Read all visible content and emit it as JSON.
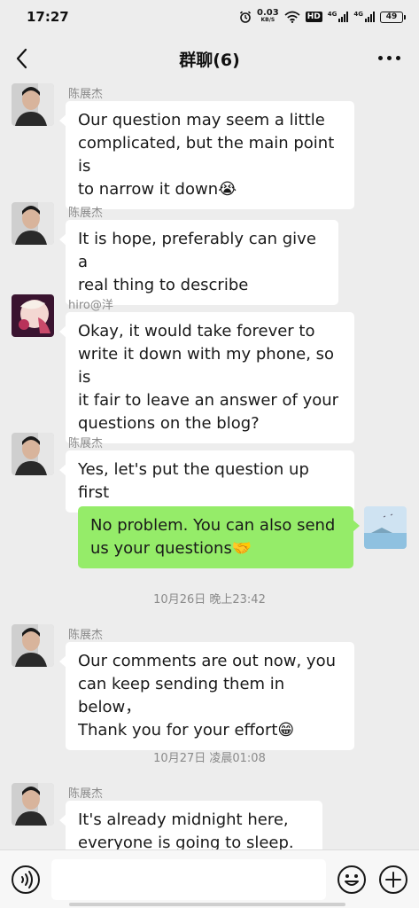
{
  "status_bar": {
    "time": "17:27",
    "net_speed": "0.03",
    "net_speed_unit": "KB/S",
    "hd_label": "HD",
    "signal1_label": "4G",
    "signal2_label": "4G",
    "battery": "49"
  },
  "header": {
    "title": "群聊(6)"
  },
  "messages": [
    {
      "sender": "陈展杰",
      "lines": [
        "Our question may seem a little",
        "complicated, but the main point is",
        "to narrow it down😭"
      ]
    },
    {
      "sender": "陈展杰",
      "lines": [
        "It is hope, preferably can give a",
        "real thing to describe"
      ]
    },
    {
      "sender": "hiro@洋",
      "lines": [
        "Okay, it would take forever to",
        "write it down with my phone, so is",
        "it fair to leave an answer of your",
        "questions on the blog?"
      ]
    },
    {
      "sender": "陈展杰",
      "lines": [
        "Yes, let's put the question up first"
      ]
    },
    {
      "sender": "",
      "lines": [
        "No problem. You can also send",
        "us your questions🤝"
      ]
    },
    {
      "sender": "陈展杰",
      "lines": [
        "Our comments are out now, you",
        "can keep sending them in below，",
        "Thank you for your effort😁"
      ]
    },
    {
      "sender": "陈展杰",
      "lines": [
        "It's already midnight here,",
        "everyone is going to sleep."
      ]
    }
  ],
  "timestamps": [
    "10月26日 晚上23:42",
    "10月27日 凌晨01:08"
  ],
  "input": {
    "placeholder": ""
  },
  "colors": {
    "background": "#ededed",
    "incoming_bubble": "#ffffff",
    "outgoing_bubble": "#95ec69",
    "meta_text": "#8a8a8a"
  },
  "icons": {
    "back": "chevron-left-icon",
    "more": "more-dots-icon",
    "voice": "voice-icon",
    "emoji": "emoji-icon",
    "plus": "plus-icon"
  }
}
